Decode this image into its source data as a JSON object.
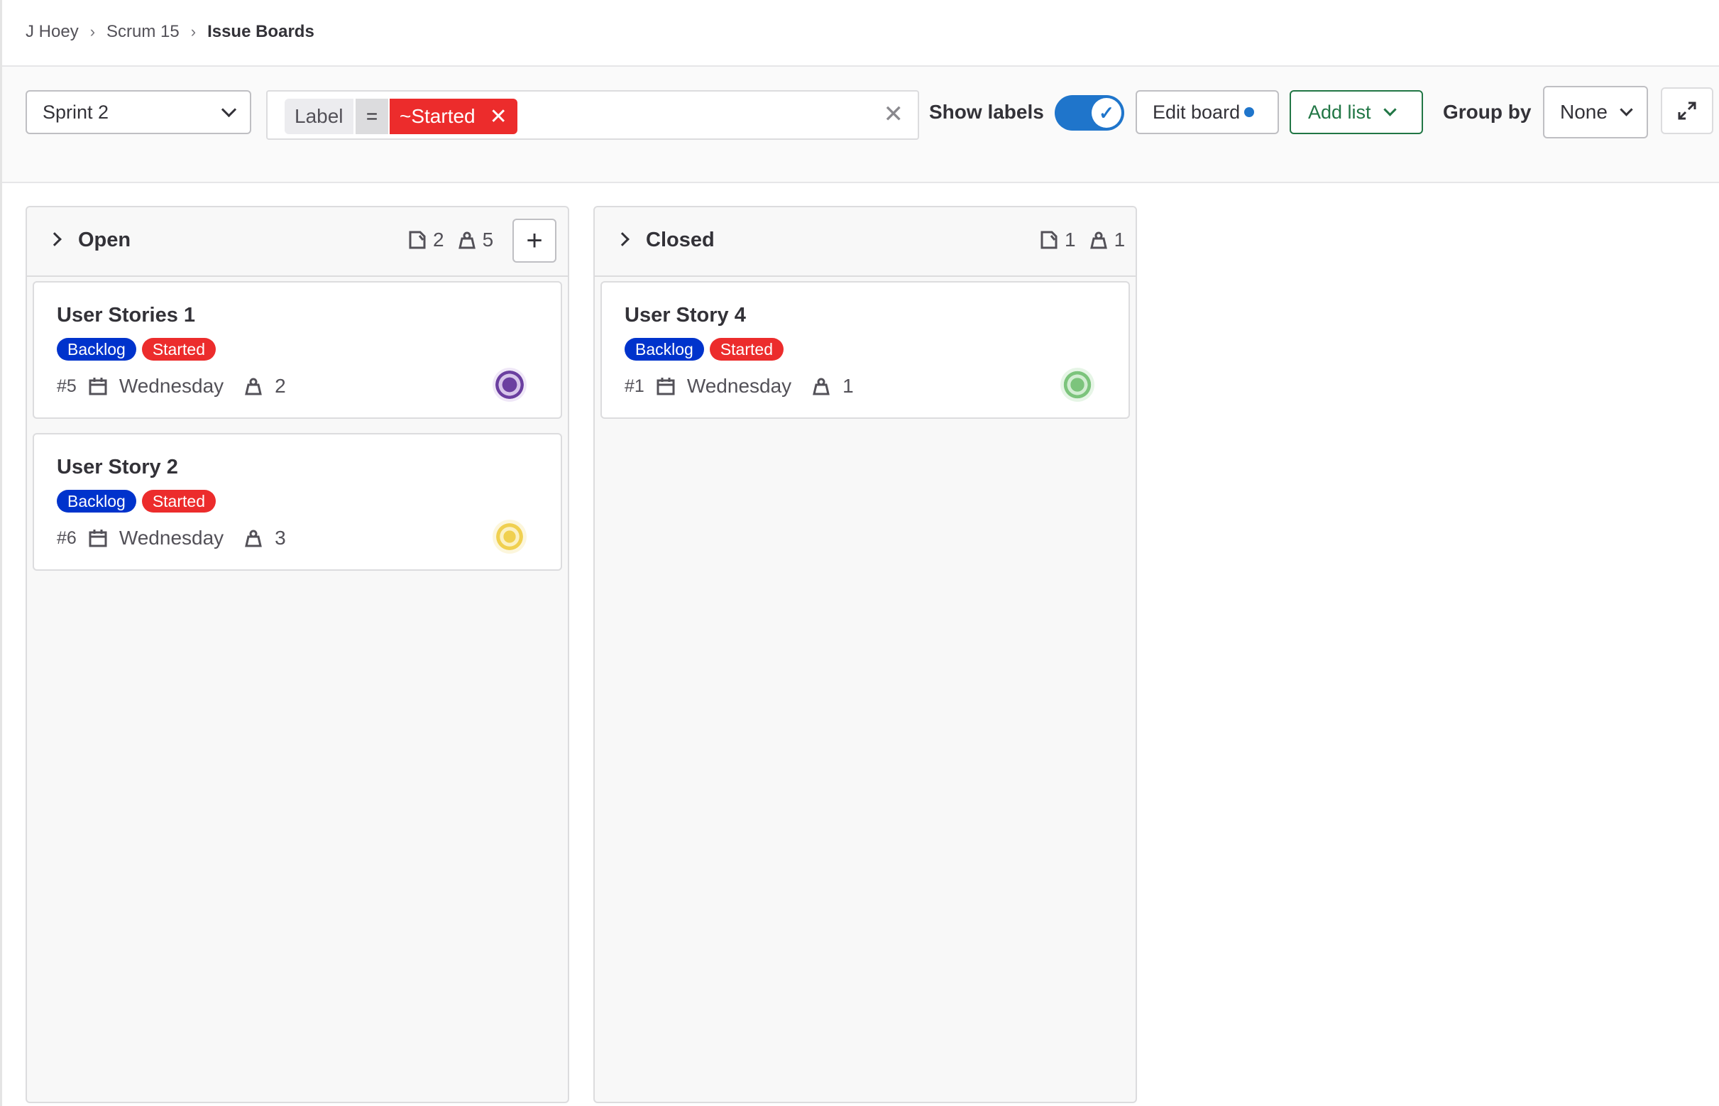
{
  "breadcrumb": {
    "items": [
      "J Hoey",
      "Scrum 15",
      "Issue Boards"
    ]
  },
  "filter_bar": {
    "milestone_select": "Sprint 2",
    "token": {
      "key": "Label",
      "operator": "=",
      "value": "~Started"
    },
    "show_labels_label": "Show labels",
    "show_labels_on": true,
    "edit_board_label": "Edit board",
    "add_list_label": "Add list",
    "group_by_label": "Group by",
    "group_by_value": "None"
  },
  "lists": [
    {
      "title": "Open",
      "issue_count": "2",
      "weight_count": "5",
      "cards": [
        {
          "title": "User Stories 1",
          "labels": [
            "Backlog",
            "Started"
          ],
          "ref": "#5",
          "due": "Wednesday",
          "weight": "2",
          "avatar_color": "#6b3fa0"
        },
        {
          "title": "User Story 2",
          "labels": [
            "Backlog",
            "Started"
          ],
          "ref": "#6",
          "due": "Wednesday",
          "weight": "3",
          "avatar_color": "#f0d050"
        }
      ]
    },
    {
      "title": "Closed",
      "issue_count": "1",
      "weight_count": "1",
      "cards": [
        {
          "title": "User Story 4",
          "labels": [
            "Backlog",
            "Started"
          ],
          "ref": "#1",
          "due": "Wednesday",
          "weight": "1",
          "avatar_color": "#7cc47c"
        }
      ]
    }
  ],
  "colors": {
    "accent": "#1f75cb",
    "started": "#ec2c2c",
    "backlog": "#0033cc",
    "add_list": "#217645"
  }
}
